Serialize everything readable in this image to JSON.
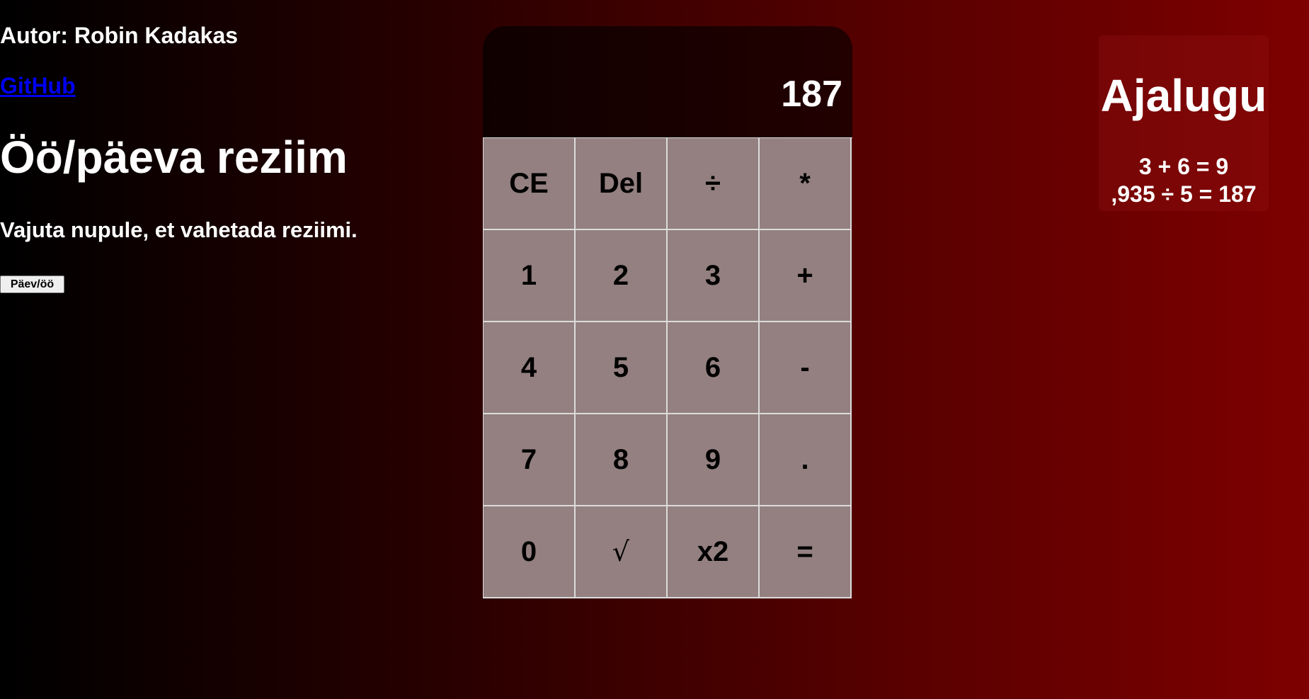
{
  "sidebar": {
    "author": "Autor: Robin Kadakas",
    "github_link": "GitHub",
    "mode_title": "Öö/päeva reziim",
    "mode_hint": "Vajuta nupule, et vahetada reziimi.",
    "mode_button": "Päev/öö"
  },
  "calculator": {
    "display": "187",
    "keys": [
      "CE",
      "Del",
      "÷",
      "*",
      "1",
      "2",
      "3",
      "+",
      "4",
      "5",
      "6",
      "-",
      "7",
      "8",
      "9",
      ".",
      "0",
      "√",
      "x2",
      "="
    ]
  },
  "history": {
    "title": "Ajalugu",
    "entries": [
      "3 + 6 = 9",
      ",935 ÷ 5 = 187"
    ]
  },
  "colors": {
    "link": "#0000ee",
    "key_background": "#948080",
    "key_border": "#dcdcdc",
    "background_start": "#000000",
    "background_end": "#7e0000"
  }
}
